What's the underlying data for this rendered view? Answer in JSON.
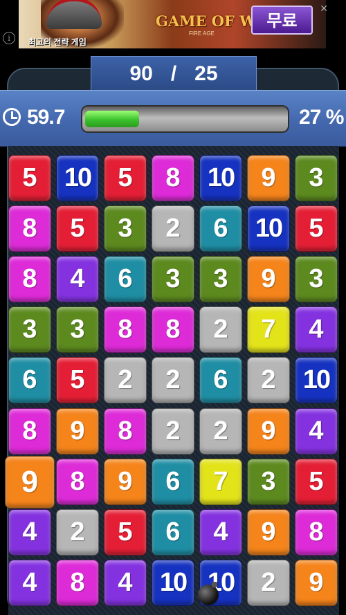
{
  "ad": {
    "tagline": "최고의 전략 게임",
    "logo": "GAME OF WAR",
    "logo_sub": "FIRE AGE",
    "cta": "무료",
    "info": "i",
    "close": "✕"
  },
  "score": {
    "current": "90",
    "separator": "/",
    "target": "25"
  },
  "status": {
    "time": "59.7",
    "progress_percent": 27,
    "percent_label": "27 %"
  },
  "colors": {
    "red": "#e41f35",
    "blue": "#1632c0",
    "magenta": "#de2bd8",
    "orange": "#f5841b",
    "green": "#5c8a1f",
    "gray": "#b6b6b6",
    "teal": "#1f8ea4",
    "purple": "#8432e0",
    "yellow": "#e3e31a"
  },
  "board": {
    "rows": [
      [
        {
          "v": "5",
          "c": "red"
        },
        {
          "v": "10",
          "c": "blue"
        },
        {
          "v": "5",
          "c": "red"
        },
        {
          "v": "8",
          "c": "magenta"
        },
        {
          "v": "10",
          "c": "blue"
        },
        {
          "v": "9",
          "c": "orange"
        },
        {
          "v": "3",
          "c": "green"
        }
      ],
      [
        {
          "v": "8",
          "c": "magenta"
        },
        {
          "v": "5",
          "c": "red"
        },
        {
          "v": "3",
          "c": "green"
        },
        {
          "v": "2",
          "c": "gray"
        },
        {
          "v": "6",
          "c": "teal"
        },
        {
          "v": "10",
          "c": "blue"
        },
        {
          "v": "5",
          "c": "red"
        }
      ],
      [
        {
          "v": "8",
          "c": "magenta"
        },
        {
          "v": "4",
          "c": "purple"
        },
        {
          "v": "6",
          "c": "teal"
        },
        {
          "v": "3",
          "c": "green"
        },
        {
          "v": "3",
          "c": "green"
        },
        {
          "v": "9",
          "c": "orange"
        },
        {
          "v": "3",
          "c": "green"
        }
      ],
      [
        {
          "v": "3",
          "c": "green"
        },
        {
          "v": "3",
          "c": "green"
        },
        {
          "v": "8",
          "c": "magenta"
        },
        {
          "v": "8",
          "c": "magenta"
        },
        {
          "v": "2",
          "c": "gray"
        },
        {
          "v": "7",
          "c": "yellow"
        },
        {
          "v": "4",
          "c": "purple"
        }
      ],
      [
        {
          "v": "6",
          "c": "teal"
        },
        {
          "v": "5",
          "c": "red"
        },
        {
          "v": "2",
          "c": "gray"
        },
        {
          "v": "2",
          "c": "gray"
        },
        {
          "v": "6",
          "c": "teal"
        },
        {
          "v": "2",
          "c": "gray"
        },
        {
          "v": "10",
          "c": "blue"
        }
      ],
      [
        {
          "v": "8",
          "c": "magenta"
        },
        {
          "v": "9",
          "c": "orange"
        },
        {
          "v": "8",
          "c": "magenta"
        },
        {
          "v": "2",
          "c": "gray"
        },
        {
          "v": "2",
          "c": "gray"
        },
        {
          "v": "9",
          "c": "orange"
        },
        {
          "v": "4",
          "c": "purple"
        }
      ],
      [
        {
          "v": "9",
          "c": "orange",
          "selected": true
        },
        {
          "v": "8",
          "c": "magenta"
        },
        {
          "v": "9",
          "c": "orange"
        },
        {
          "v": "6",
          "c": "teal"
        },
        {
          "v": "7",
          "c": "yellow"
        },
        {
          "v": "3",
          "c": "green"
        },
        {
          "v": "5",
          "c": "red"
        }
      ],
      [
        {
          "v": "4",
          "c": "purple"
        },
        {
          "v": "2",
          "c": "gray"
        },
        {
          "v": "5",
          "c": "red"
        },
        {
          "v": "6",
          "c": "teal"
        },
        {
          "v": "4",
          "c": "purple"
        },
        {
          "v": "9",
          "c": "orange"
        },
        {
          "v": "8",
          "c": "magenta"
        }
      ],
      [
        {
          "v": "4",
          "c": "purple"
        },
        {
          "v": "8",
          "c": "magenta"
        },
        {
          "v": "4",
          "c": "purple"
        },
        {
          "v": "10",
          "c": "blue"
        },
        {
          "v": "10",
          "c": "blue",
          "bomb": true
        },
        {
          "v": "2",
          "c": "gray"
        },
        {
          "v": "9",
          "c": "orange"
        }
      ]
    ]
  }
}
